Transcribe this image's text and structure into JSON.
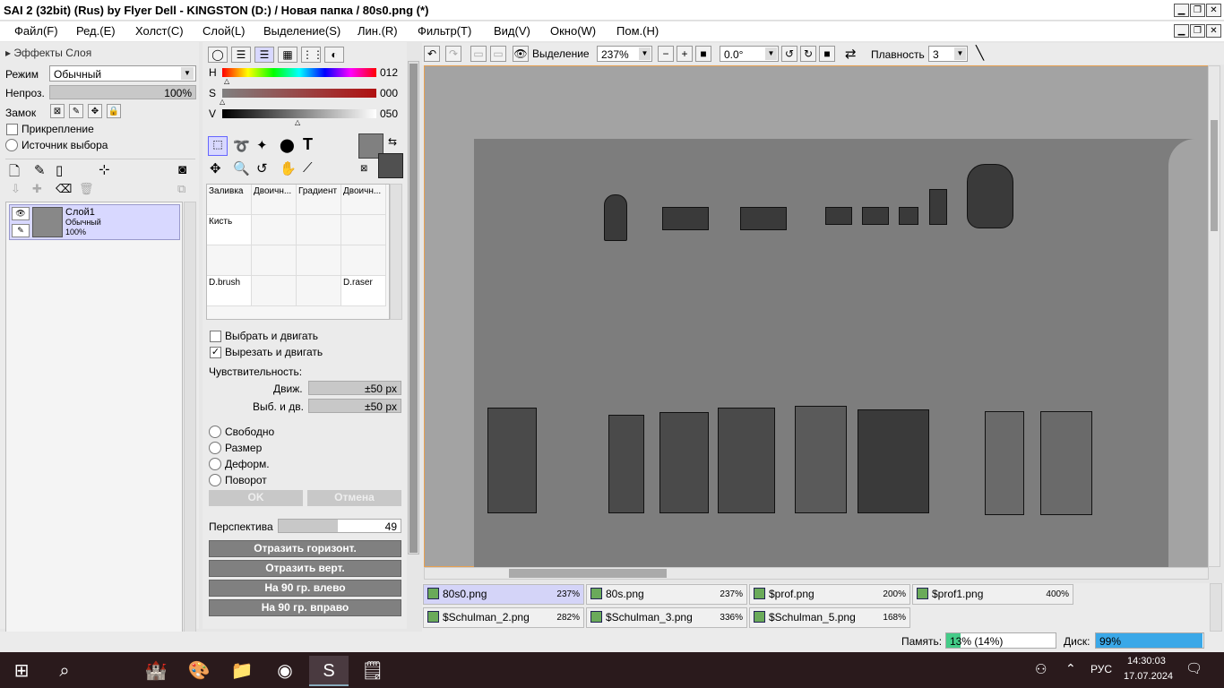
{
  "window": {
    "title": "SAI 2 (32bit) (Rus) by Flyer Dell - KINGSTON (D:) / Новая папка / 80s0.png (*)"
  },
  "menu": [
    "Файл(F)",
    "Ред.(E)",
    "Холст(C)",
    "Слой(L)",
    "Выделение(S)",
    "Лин.(R)",
    "Фильтр(T)",
    "Вид(V)",
    "Окно(W)",
    "Пом.(H)"
  ],
  "layer_panel": {
    "effects": "Эффекты Слоя",
    "mode_label": "Режим",
    "mode_value": "Обычный",
    "opacity_label": "Непроз.",
    "opacity_value": "100%",
    "lock_label": "Замок",
    "clip_label": "Прикрепление",
    "source_label": "Источник выбора",
    "layer": {
      "name": "Слой1",
      "mode": "Обычный",
      "opacity": "100%"
    }
  },
  "color_panel": {
    "h_label": "H",
    "h": "012",
    "s_label": "S",
    "s": "000",
    "v_label": "V",
    "v": "050"
  },
  "brushes": [
    [
      "Заливка",
      "Двоичн...",
      "Градиент",
      "Двоичн..."
    ],
    [
      "Кисть",
      "",
      "",
      ""
    ],
    [
      "",
      "",
      "",
      ""
    ],
    [
      "D.brush",
      "",
      "",
      "D.raser"
    ]
  ],
  "tool_options": {
    "select_move": "Выбрать и двигать",
    "cut_move": "Вырезать и двигать",
    "sensitivity": "Чувствительность:",
    "move_label": "Движ.",
    "move_value": "±50 px",
    "selmove_label": "Выб. и дв.",
    "selmove_value": "±50 px",
    "radios": [
      "Свободно",
      "Размер",
      "Деформ.",
      "Поворот"
    ],
    "ok": "OK",
    "cancel": "Отмена",
    "perspective_label": "Перспектива",
    "perspective_value": "49",
    "flip_h": "Отразить горизонт.",
    "flip_v": "Отразить верт.",
    "rot_left": "На 90 гр. влево",
    "rot_right": "На 90 гр. вправо"
  },
  "view_toolbar": {
    "selection": "Выделение",
    "zoom": "237%",
    "angle": "0.0°",
    "smooth_label": "Плавность",
    "smooth_value": "3"
  },
  "tabs": [
    {
      "name": "80s0.png",
      "pct": "237%"
    },
    {
      "name": "80s.png",
      "pct": "237%"
    },
    {
      "name": "$prof.png",
      "pct": "200%"
    },
    {
      "name": "$prof1.png",
      "pct": "400%"
    },
    {
      "name": "$Schulman_2.png",
      "pct": "282%"
    },
    {
      "name": "$Schulman_3.png",
      "pct": "336%"
    },
    {
      "name": "$Schulman_5.png",
      "pct": "168%"
    }
  ],
  "status": {
    "mem_label": "Память:",
    "mem_value": "13% (14%)",
    "mem_fill": 0.13,
    "disk_label": "Диск:",
    "disk_value": "99%",
    "disk_fill": 0.99
  },
  "taskbar": {
    "lang": "РУС",
    "time": "14:30:03",
    "date": "17.07.2024"
  },
  "colors": {
    "accent": "#e8a050",
    "tab_active": "#d4d4f8",
    "disk_bar": "#3aa8e8",
    "mem_bar": "#44cc88"
  }
}
